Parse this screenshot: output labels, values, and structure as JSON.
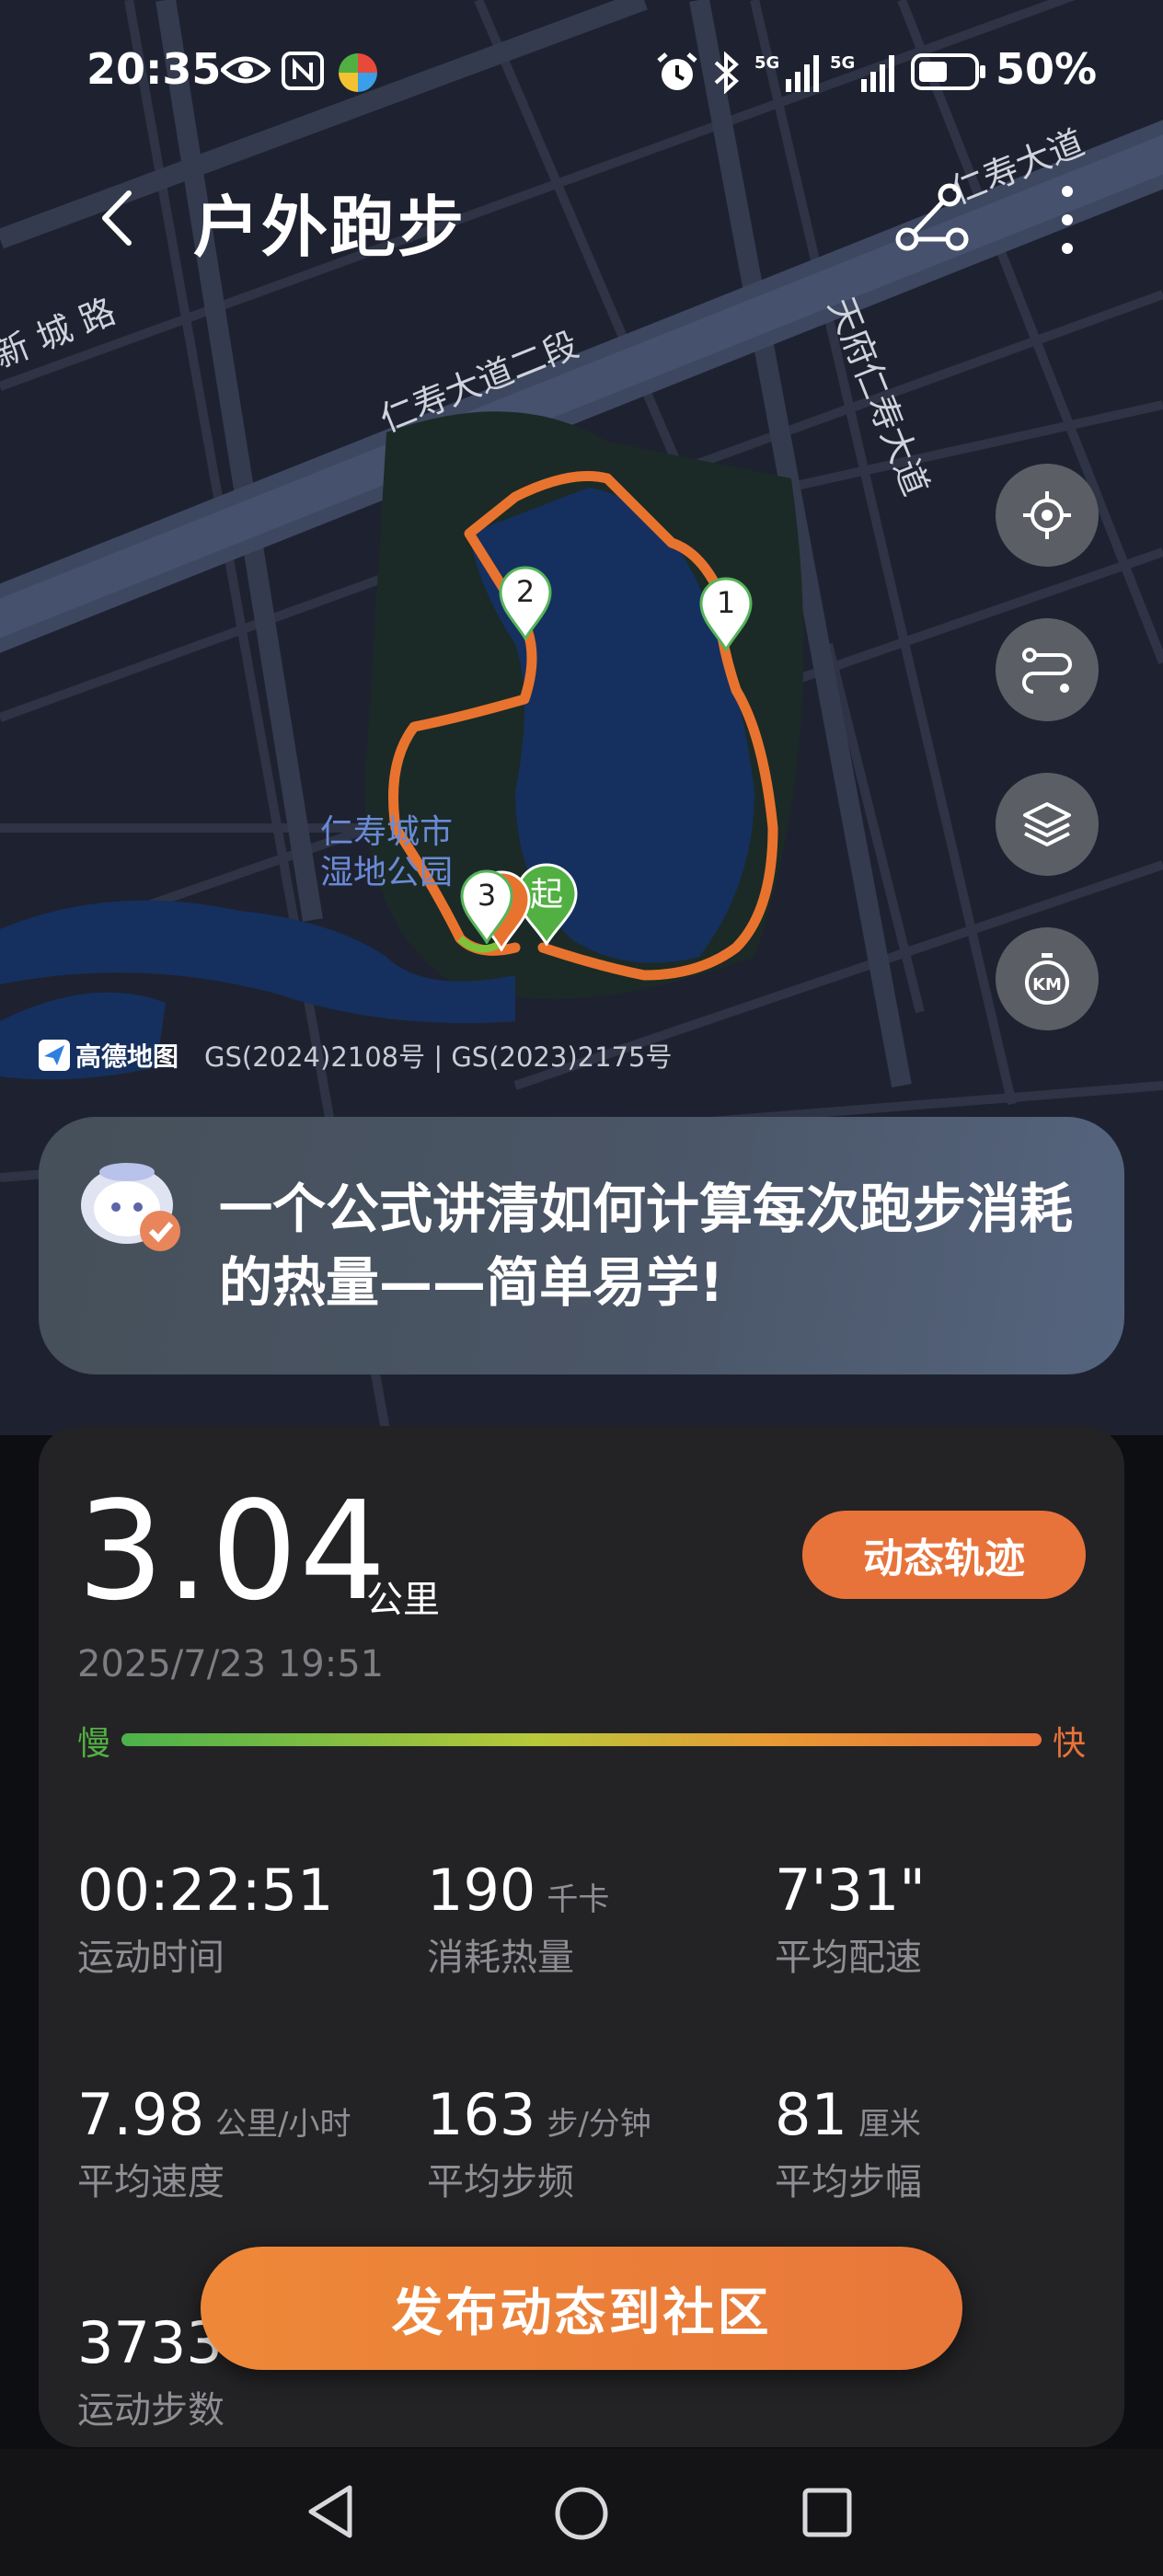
{
  "status_bar": {
    "time": "20:35",
    "battery": "50%",
    "network_labels": [
      "5G",
      "5G"
    ]
  },
  "header": {
    "title": "户外跑步"
  },
  "map": {
    "road_labels": [
      "仁寿大道",
      "新 城 路",
      "仁寿大道二段",
      "天府仁寿大道"
    ],
    "park_label_lines": [
      "仁寿城市",
      "湿地公园"
    ],
    "markers": [
      "1",
      "2",
      "3"
    ],
    "start_marker": "起",
    "attribution_logo": "高德地图",
    "attribution_text": "GS(2024)2108号 | GS(2023)2175号",
    "colors": {
      "route": "#e8732e",
      "water": "#15305e",
      "land": "#1e2230"
    }
  },
  "side_controls": [
    "locate-icon",
    "route-toggle-icon",
    "layers-icon",
    "km-timer-icon"
  ],
  "banner": {
    "text": "一个公式讲清如何计算每次跑步消耗的热量——简单易学!"
  },
  "summary": {
    "distance": "3.04",
    "distance_unit": "公里",
    "dynamic_track_label": "动态轨迹",
    "datetime": "2025/7/23 19:51",
    "pace_slow": "慢",
    "pace_fast": "快"
  },
  "stats": [
    {
      "value": "00:22:51",
      "unit": "",
      "label": "运动时间"
    },
    {
      "value": "190",
      "unit": "千卡",
      "label": "消耗热量"
    },
    {
      "value": "7'31\"",
      "unit": "",
      "label": "平均配速"
    },
    {
      "value": "7.98",
      "unit": "公里/小时",
      "label": "平均速度"
    },
    {
      "value": "163",
      "unit": "步/分钟",
      "label": "平均步频"
    },
    {
      "value": "81",
      "unit": "厘米",
      "label": "平均步幅"
    },
    {
      "value": "3733",
      "unit": "",
      "label": "运动步数"
    }
  ],
  "publish_button": "发布动态到社区",
  "accent_color": "#e8733a"
}
